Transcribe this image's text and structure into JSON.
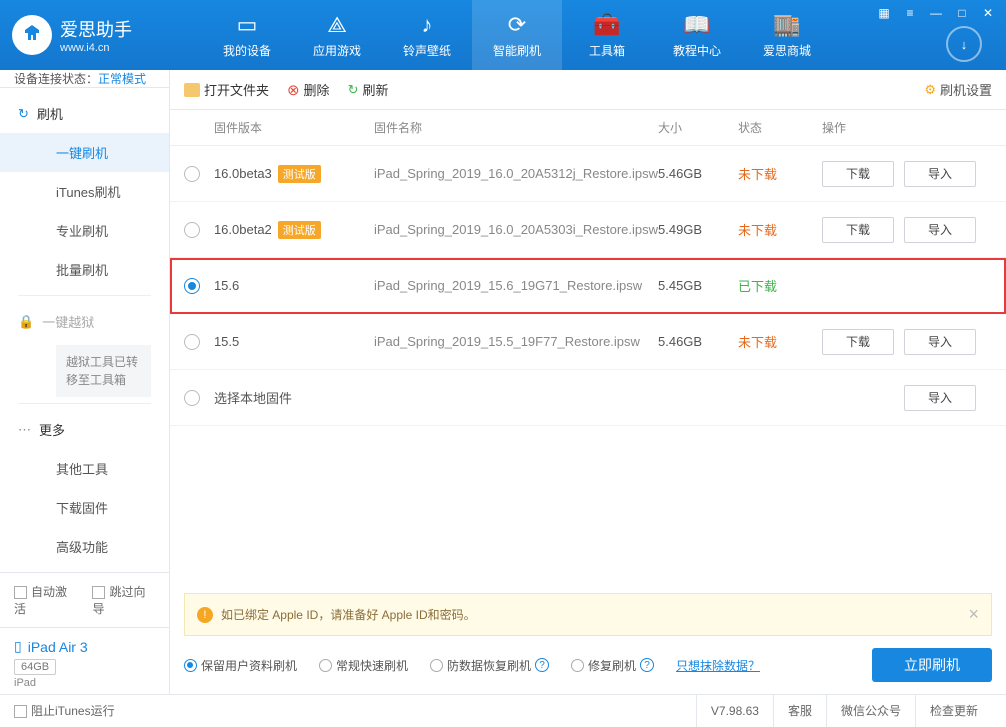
{
  "app": {
    "title": "爱思助手",
    "url": "www.i4.cn"
  },
  "nav": [
    {
      "label": "我的设备"
    },
    {
      "label": "应用游戏"
    },
    {
      "label": "铃声壁纸"
    },
    {
      "label": "智能刷机"
    },
    {
      "label": "工具箱"
    },
    {
      "label": "教程中心"
    },
    {
      "label": "爱思商城"
    }
  ],
  "status": {
    "prefix": "设备连接状态：",
    "mode": "正常模式"
  },
  "sidebar": {
    "flash_heading": "刷机",
    "items": [
      "一键刷机",
      "iTunes刷机",
      "专业刷机",
      "批量刷机"
    ],
    "jailbreak_heading": "一键越狱",
    "jailbreak_note": "越狱工具已转移至工具箱",
    "more_heading": "更多",
    "more_items": [
      "其他工具",
      "下载固件",
      "高级功能"
    ],
    "auto_activate": "自动激活",
    "skip_wizard": "跳过向导"
  },
  "device": {
    "name": "iPad Air 3",
    "capacity": "64GB",
    "type": "iPad"
  },
  "toolbar": {
    "open": "打开文件夹",
    "delete": "删除",
    "refresh": "刷新",
    "settings": "刷机设置"
  },
  "table": {
    "headers": {
      "version": "固件版本",
      "name": "固件名称",
      "size": "大小",
      "status": "状态",
      "ops": "操作"
    },
    "rows": [
      {
        "version": "16.0beta3",
        "beta": "测试版",
        "name": "iPad_Spring_2019_16.0_20A5312j_Restore.ipsw",
        "size": "5.46GB",
        "status": "未下载",
        "download": "下载",
        "import": "导入",
        "selected": false,
        "downloaded": false
      },
      {
        "version": "16.0beta2",
        "beta": "测试版",
        "name": "iPad_Spring_2019_16.0_20A5303i_Restore.ipsw",
        "size": "5.49GB",
        "status": "未下载",
        "download": "下载",
        "import": "导入",
        "selected": false,
        "downloaded": false
      },
      {
        "version": "15.6",
        "beta": "",
        "name": "iPad_Spring_2019_15.6_19G71_Restore.ipsw",
        "size": "5.45GB",
        "status": "已下载",
        "download": "",
        "import": "",
        "selected": true,
        "downloaded": true
      },
      {
        "version": "15.5",
        "beta": "",
        "name": "iPad_Spring_2019_15.5_19F77_Restore.ipsw",
        "size": "5.46GB",
        "status": "未下载",
        "download": "下载",
        "import": "导入",
        "selected": false,
        "downloaded": false
      }
    ],
    "local_row": {
      "label": "选择本地固件",
      "import": "导入"
    }
  },
  "warning": "如已绑定 Apple ID，请准备好 Apple ID和密码。",
  "options": {
    "keep_data": "保留用户资料刷机",
    "normal": "常规快速刷机",
    "anti_recovery": "防数据恢复刷机",
    "repair": "修复刷机",
    "erase_only": "只想抹除数据？",
    "flash_btn": "立即刷机"
  },
  "footer": {
    "block_itunes": "阻止iTunes运行",
    "version": "V7.98.63",
    "support": "客服",
    "wechat": "微信公众号",
    "update": "检查更新"
  }
}
